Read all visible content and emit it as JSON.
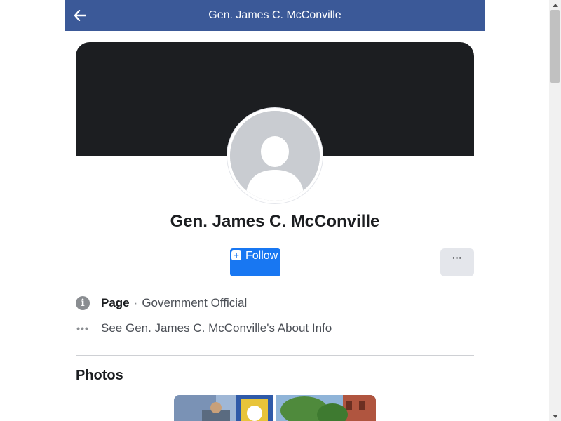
{
  "header": {
    "title": "Gen. James C. McConville",
    "back_icon": "back-arrow-icon",
    "bg_color": "#3b5998"
  },
  "profile": {
    "name": "Gen. James C. McConville",
    "avatar_icon": "default-avatar-icon"
  },
  "actions": {
    "follow_label": "Follow",
    "follow_icon": "plus-icon",
    "more_label": "···",
    "accent_color": "#1877f2"
  },
  "info": {
    "page_label": "Page",
    "separator": "·",
    "category": "Government Official",
    "about_link": "See Gen. James C. McConville's About Info",
    "info_icon": "info-icon",
    "more_icon": "ellipsis-icon"
  },
  "photos": {
    "title": "Photos"
  }
}
